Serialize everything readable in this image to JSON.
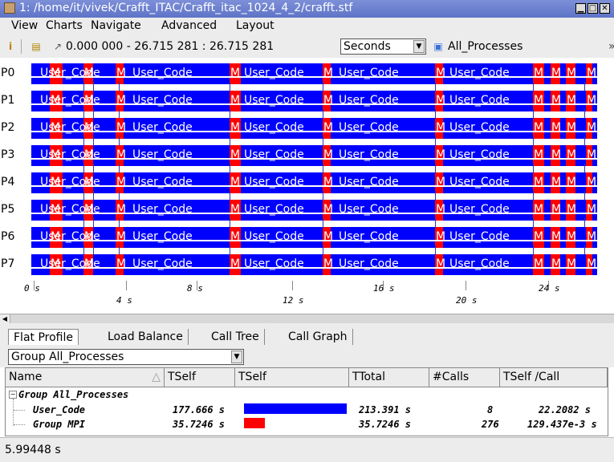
{
  "window": {
    "title": "1: /home/it/vivek/Crafft_ITAC/Crafft_itac_1024_4_2/crafft.stf",
    "buttons": [
      "▁",
      "□",
      "✕"
    ]
  },
  "menu": [
    "View",
    "Charts",
    "Navigate",
    "Advanced",
    "Layout"
  ],
  "toolbar": {
    "time_range": "0.000 000 - 26.715 281 : 26.715 281",
    "unit_select": "Seconds",
    "process_group": "All_Processes"
  },
  "timeline": {
    "processes": [
      "P0",
      "P1",
      "P2",
      "P3",
      "P4",
      "P5",
      "P6",
      "P7"
    ],
    "segment_label": "User_Code",
    "mpi_label": "M",
    "axis_ticks": [
      "0 s",
      "4 s",
      "8 s",
      "12 s",
      "16 s",
      "20 s",
      "24 s"
    ],
    "colors": {
      "user_code": "#0000ff",
      "mpi": "#ff0000"
    }
  },
  "tabs": [
    "Flat Profile",
    "Load Balance",
    "Call Tree",
    "Call Graph"
  ],
  "group_select": "Group All_Processes",
  "table": {
    "columns": [
      "Name",
      "TSelf",
      "TSelf",
      "TTotal",
      "#Calls",
      "TSelf /Call"
    ],
    "group_label": "Group All_Processes",
    "rows": [
      {
        "name": "User_Code",
        "tself": "177.666 s",
        "bar_fraction": 1.0,
        "bar_color": "#0000ff",
        "ttotal": "213.391 s",
        "calls": "8",
        "tself_per_call": "22.2082 s"
      },
      {
        "name": "Group MPI",
        "tself": "35.7246 s",
        "bar_fraction": 0.2,
        "bar_color": "#ff0000",
        "ttotal": "35.7246 s",
        "calls": "276",
        "tself_per_call": "129.437e-3 s"
      }
    ]
  },
  "status": "5.99448 s"
}
